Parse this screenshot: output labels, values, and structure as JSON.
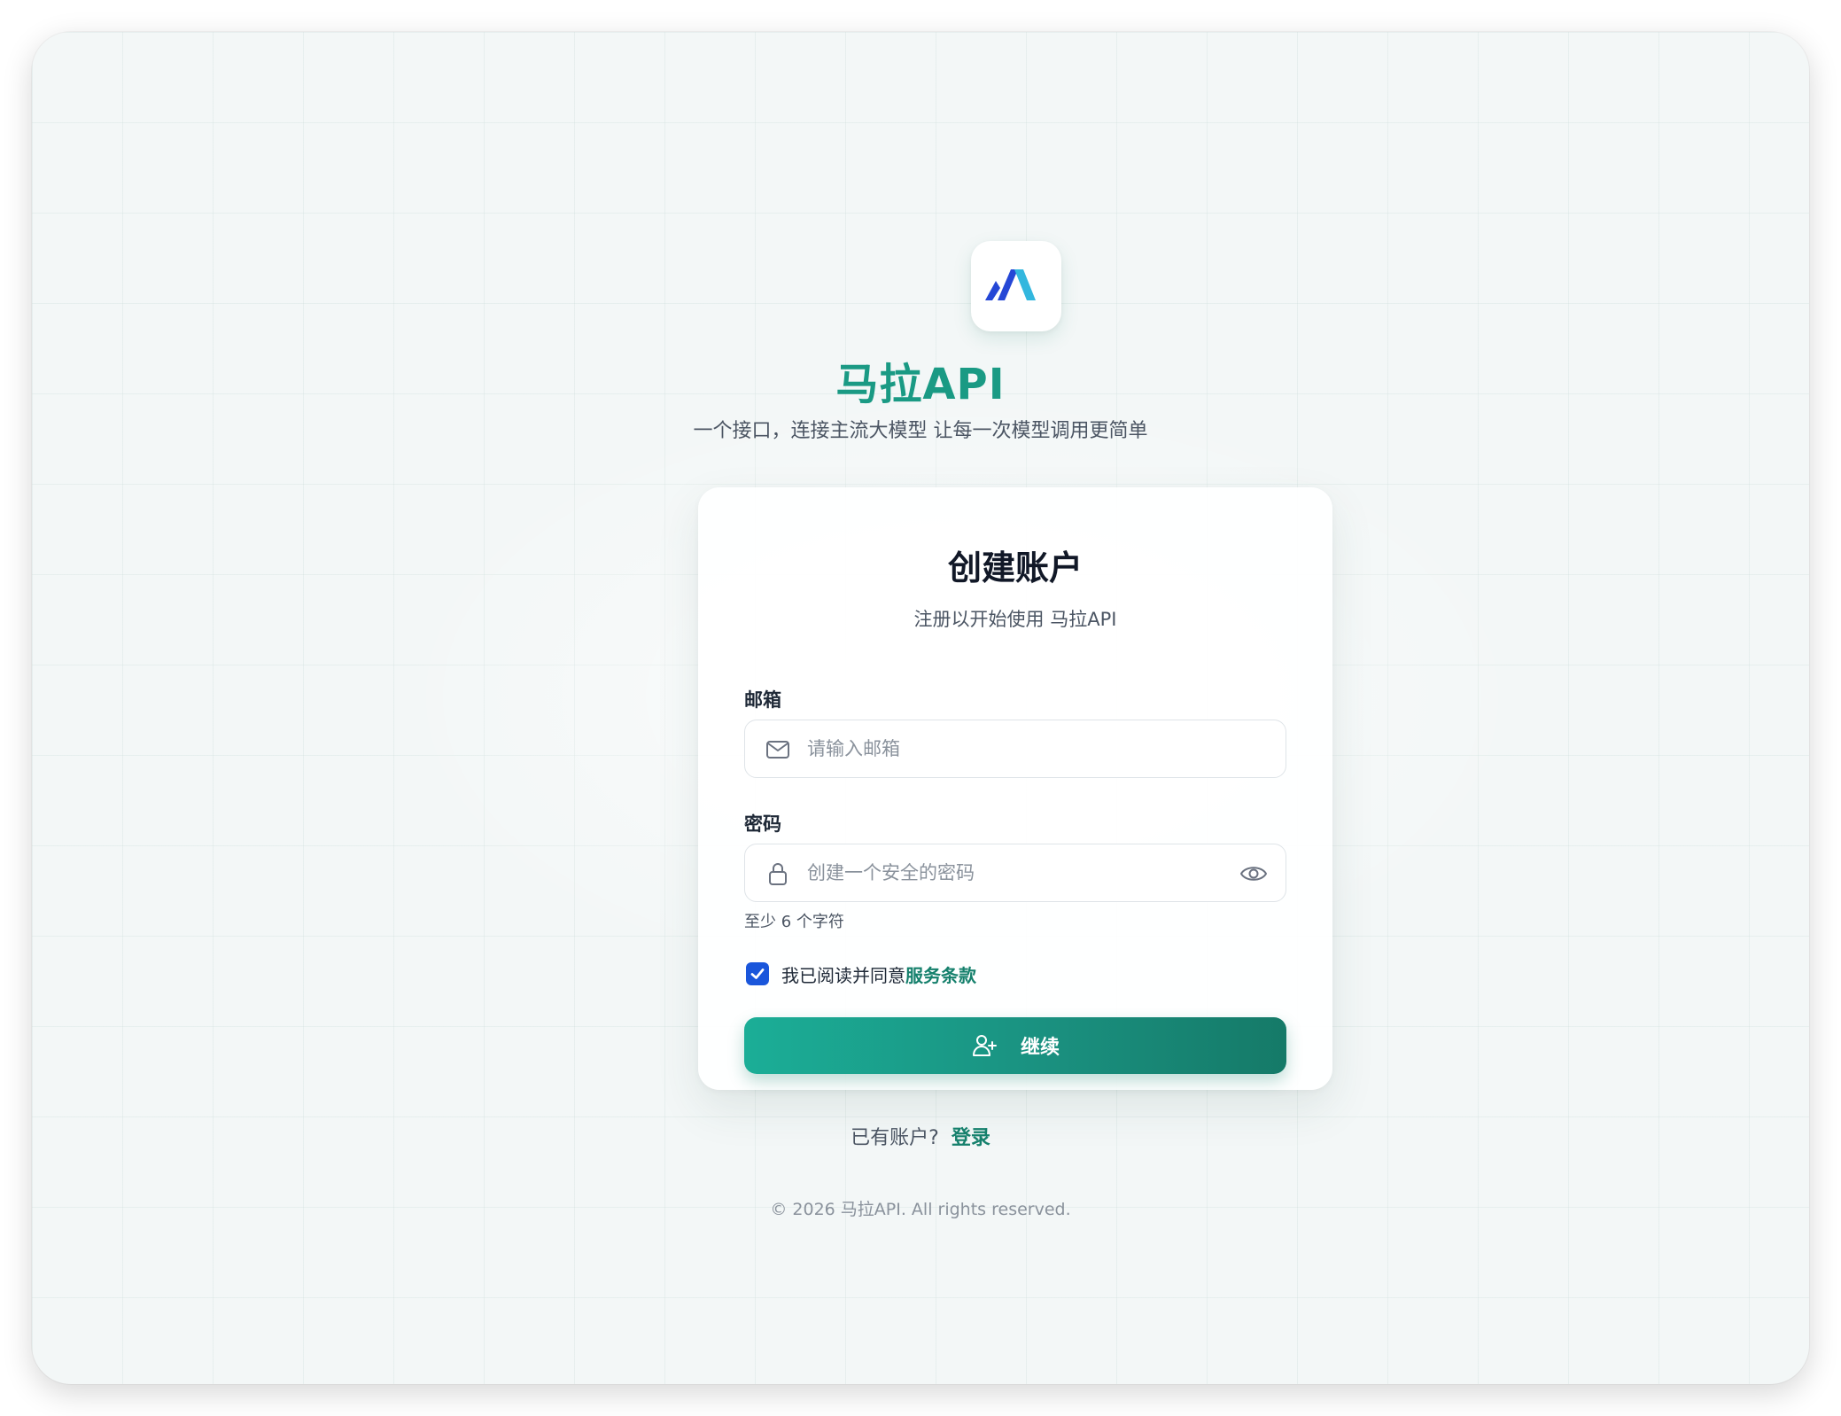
{
  "brand": {
    "name": "马拉API",
    "tagline": "一个接口，连接主流大模型 让每一次模型调用更简单",
    "logo_icon": "mala-logo-icon"
  },
  "card": {
    "title": "创建账户",
    "subtitle": "注册以开始使用 马拉API"
  },
  "form": {
    "email": {
      "label": "邮箱",
      "placeholder": "请输入邮箱",
      "value": "",
      "icon": "mail-icon"
    },
    "password": {
      "label": "密码",
      "placeholder": "创建一个安全的密码",
      "value": "",
      "icon": "lock-icon",
      "toggle_icon": "eye-icon",
      "hint": "至少 6 个字符"
    },
    "agreement": {
      "checked": true,
      "text": "我已阅读并同意",
      "link_text": "服务条款"
    },
    "submit": {
      "label": "继续",
      "icon": "user-plus-icon"
    }
  },
  "login_prompt": {
    "text": "已有账户?",
    "link_text": "登录"
  },
  "footer": {
    "copyright": "© 2026 马拉API. All rights reserved."
  },
  "colors": {
    "brand": "#1a9a84",
    "link": "#15806c",
    "checkbox": "#1a56db",
    "logo_dark": "#2547d6",
    "logo_light": "#33b7de"
  }
}
